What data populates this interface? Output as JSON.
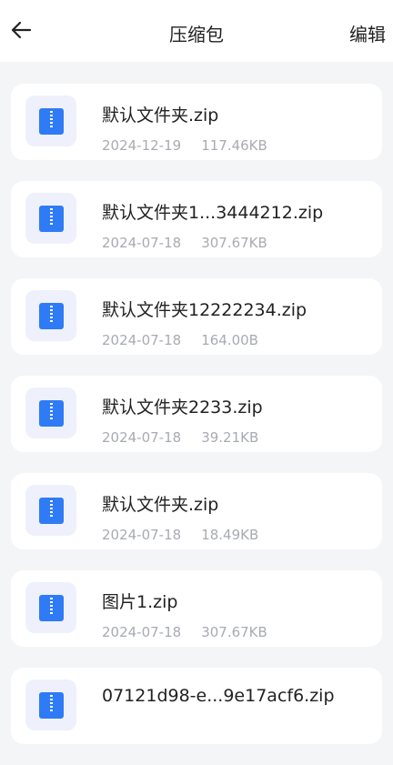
{
  "header": {
    "title": "压缩包",
    "edit_label": "编辑",
    "back_icon": "arrow-left-icon"
  },
  "files": [
    {
      "name": "默认文件夹.zip",
      "date": "2024-12-19",
      "size": "117.46KB"
    },
    {
      "name": "默认文件夹1...3444212.zip",
      "date": "2024-07-18",
      "size": "307.67KB"
    },
    {
      "name": "默认文件夹12222234.zip",
      "date": "2024-07-18",
      "size": "164.00B"
    },
    {
      "name": "默认文件夹2233.zip",
      "date": "2024-07-18",
      "size": "39.21KB"
    },
    {
      "name": "默认文件夹.zip",
      "date": "2024-07-18",
      "size": "18.49KB"
    },
    {
      "name": "图片1.zip",
      "date": "2024-07-18",
      "size": "307.67KB"
    },
    {
      "name": "07121d98-e...9e17acf6.zip",
      "date": "",
      "size": ""
    }
  ],
  "colors": {
    "accent": "#2f7bf5",
    "icon_bg": "#eef1fb",
    "background": "#f4f5f7"
  }
}
